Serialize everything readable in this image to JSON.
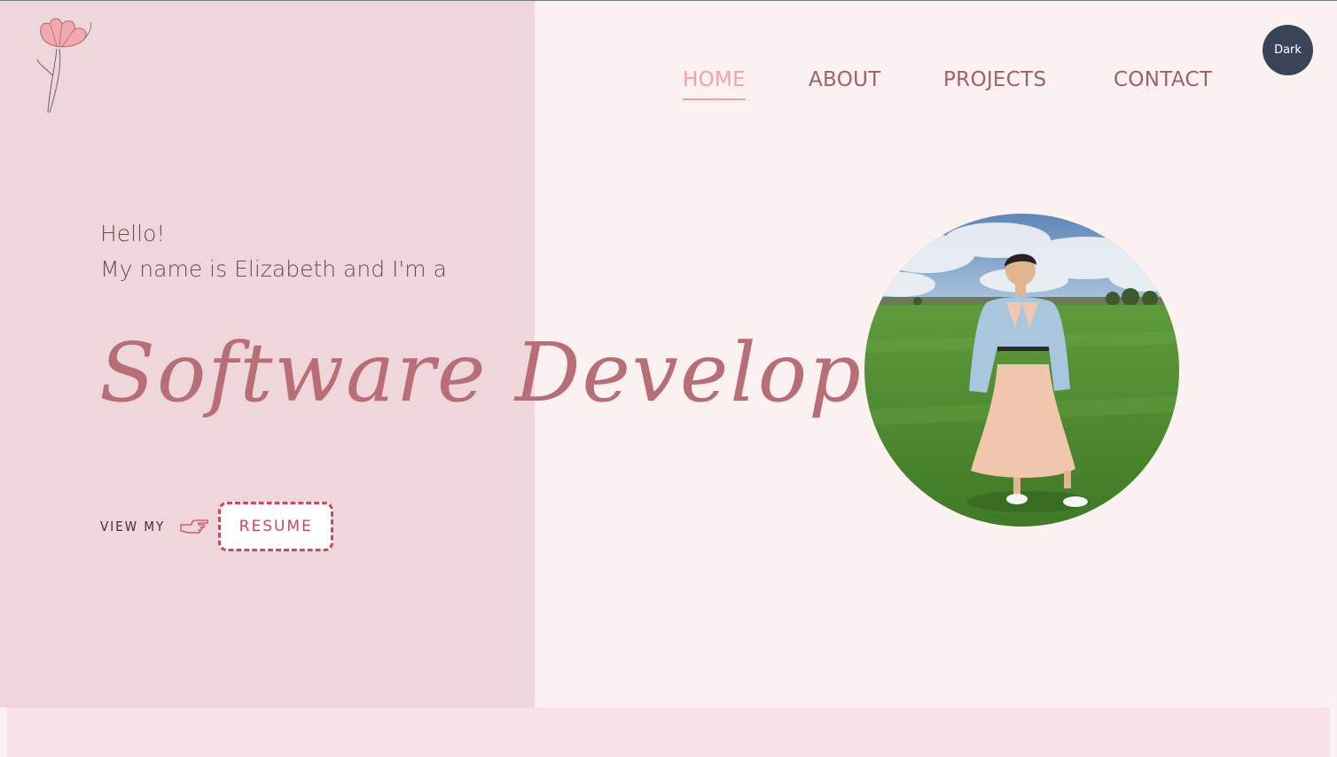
{
  "nav": {
    "items": [
      {
        "label": "HOME",
        "active": true
      },
      {
        "label": "ABOUT",
        "active": false
      },
      {
        "label": "PROJECTS",
        "active": false
      },
      {
        "label": "CONTACT",
        "active": false
      }
    ]
  },
  "theme_toggle": {
    "label": "Dark"
  },
  "hero": {
    "greeting_line1": "Hello!",
    "greeting_line2": "My name is Elizabeth and I'm a",
    "role": "Software Developer",
    "view_my": "VIEW MY",
    "pointer_icon": "pointing-hand-icon",
    "resume_label": "RESUME"
  },
  "colors": {
    "page_background": "#fcf1f1",
    "left_panel": "#eed6da",
    "bottom_strip": "#f9e2e5",
    "nav_text": "#a0606a",
    "nav_active": "#f1a3ab",
    "role_text": "#b86e76",
    "resume_accent": "#d0465e",
    "toggle_background": "#3a4458"
  },
  "logo": {
    "icon": "tulip-icon"
  },
  "photo": {
    "icon": "profile-photo"
  }
}
